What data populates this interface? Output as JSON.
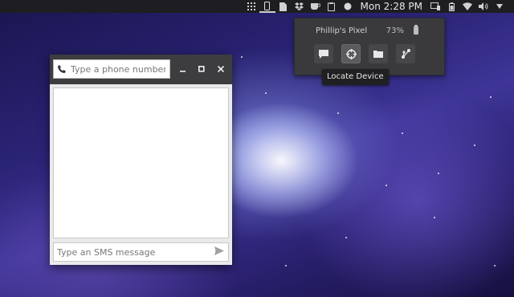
{
  "panel": {
    "indicators": [
      {
        "icon": "grid-app-icon"
      },
      {
        "icon": "phone-icon",
        "active": true
      },
      {
        "icon": "document-icon"
      },
      {
        "icon": "dropbox-icon"
      },
      {
        "icon": "coffee-icon"
      },
      {
        "icon": "clipboard-icon"
      },
      {
        "icon": "record-icon"
      }
    ],
    "clock": "Mon  2:28 PM",
    "status_icons": [
      "display-icon",
      "battery-icon",
      "wifi-icon",
      "volume-icon",
      "power-menu-icon"
    ]
  },
  "popover": {
    "device_name": "Phillip's Pixel",
    "battery": "73%",
    "actions": [
      {
        "name": "send-sms-button",
        "icon": "message-icon"
      },
      {
        "name": "locate-device-button",
        "icon": "crosshair-icon"
      },
      {
        "name": "browse-files-button",
        "icon": "folder-icon"
      },
      {
        "name": "share-button",
        "icon": "share-icon"
      }
    ]
  },
  "tooltip": {
    "text": "Locate Device"
  },
  "sms_window": {
    "phone_placeholder": "Type a phone number",
    "message_placeholder": "Type an SMS message",
    "controls": [
      "minimize",
      "maximize",
      "close"
    ]
  },
  "colors": {
    "panel_bg": "#1e1e22",
    "popover_bg": "#3a3a3d",
    "titlebar_bg": "#3d3d40"
  }
}
